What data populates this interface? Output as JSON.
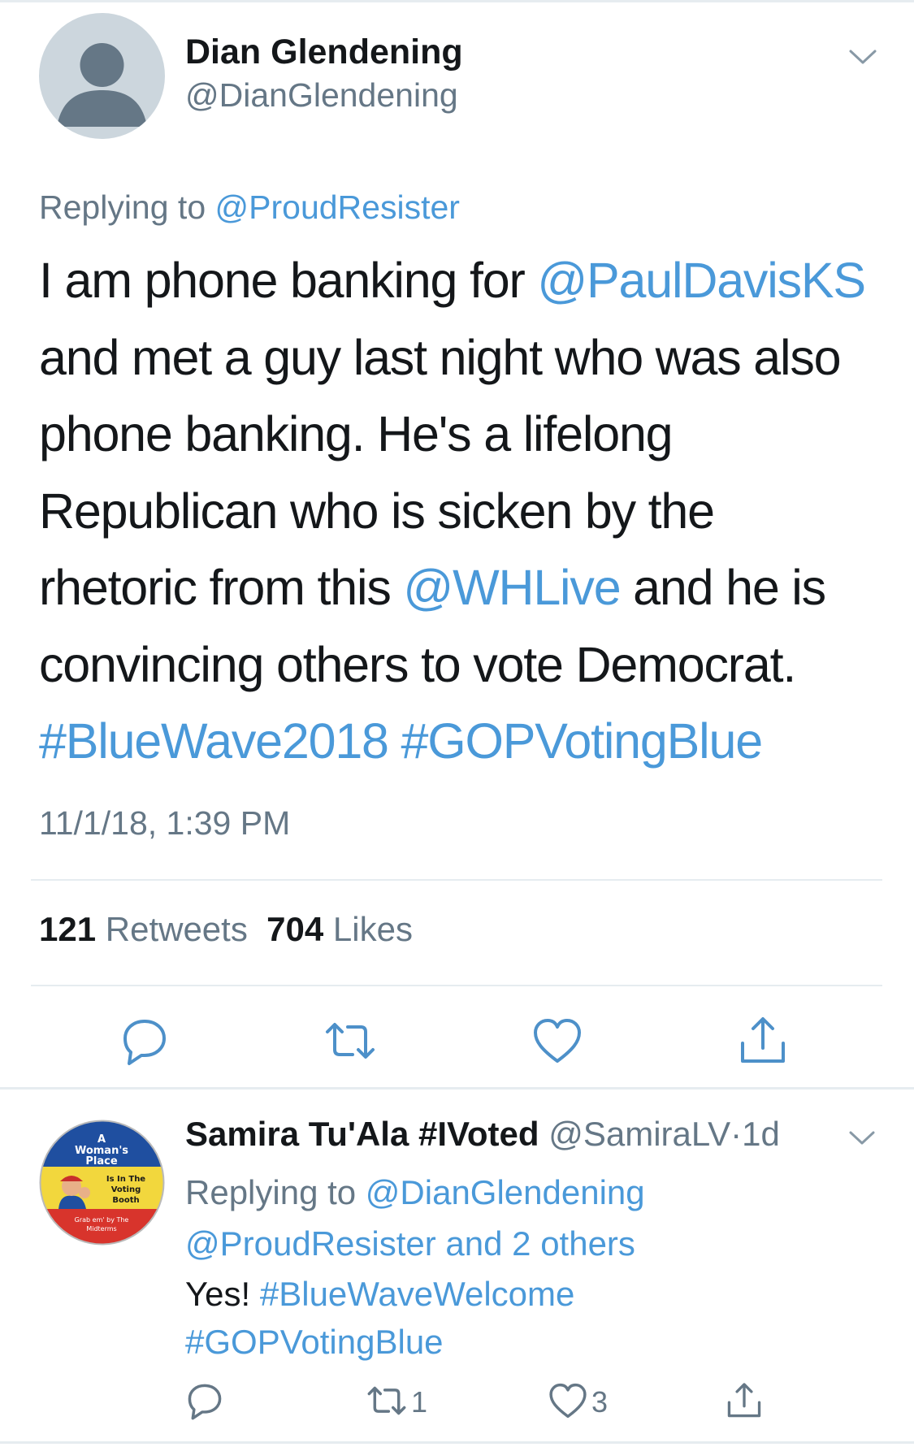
{
  "main_tweet": {
    "author_name": "Dian Glendening",
    "author_handle": "@DianGlendening",
    "replying_prefix": "Replying to ",
    "replying_to": "@ProudResister",
    "text_lines": [
      [
        {
          "t": "I am phone banking for ",
          "link": false
        },
        {
          "t": "@PaulDavisKS",
          "link": true
        }
      ],
      [
        {
          "t": "and met a guy last night who was also",
          "link": false
        }
      ],
      [
        {
          "t": "phone banking.  He's a lifelong",
          "link": false
        }
      ],
      [
        {
          "t": "Republican who is sicken by the",
          "link": false
        }
      ],
      [
        {
          "t": "rhetoric from this ",
          "link": false
        },
        {
          "t": "@WHLive",
          "link": true
        },
        {
          "t": " and he is",
          "link": false
        }
      ],
      [
        {
          "t": "convincing others to vote Democrat.",
          "link": false
        }
      ],
      [
        {
          "t": "#BlueWave2018",
          "link": true
        },
        {
          "t": " ",
          "link": false
        },
        {
          "t": "#GOPVotingBlue",
          "link": true
        }
      ]
    ],
    "timestamp": "11/1/18, 1:39 PM",
    "retweets_count": "121",
    "retweets_label": "Retweets",
    "likes_count": "704",
    "likes_label": "Likes"
  },
  "reply_tweet": {
    "author_name": "Samira Tu'Ala #IVoted",
    "author_handle": "@SamiraLV",
    "separator": "·",
    "age": "1d",
    "replying_prefix": "Replying to ",
    "replying_to_1": "@DianGlendening",
    "replying_to_2": "@ProudResister",
    "replying_suffix": " and 2 others",
    "text_prefix": "Yes! ",
    "hashtag_1": "#BlueWaveWelcome",
    "hashtag_2": "#GOPVotingBlue",
    "retweet_count": "1",
    "like_count": "3",
    "avatar_badge_text": {
      "line1": "A",
      "line2": "Woman's",
      "line3": "Place",
      "side1": "Is In The",
      "side2": "Voting",
      "side3": "Booth",
      "bottom1": "Grab em' by The",
      "bottom2": "Midterms"
    }
  },
  "colors": {
    "link": "#4a99d9",
    "secondary_text": "#657786",
    "primary_text": "#14171a",
    "divider": "#e6ecf0",
    "icon": "#4d90c9"
  }
}
